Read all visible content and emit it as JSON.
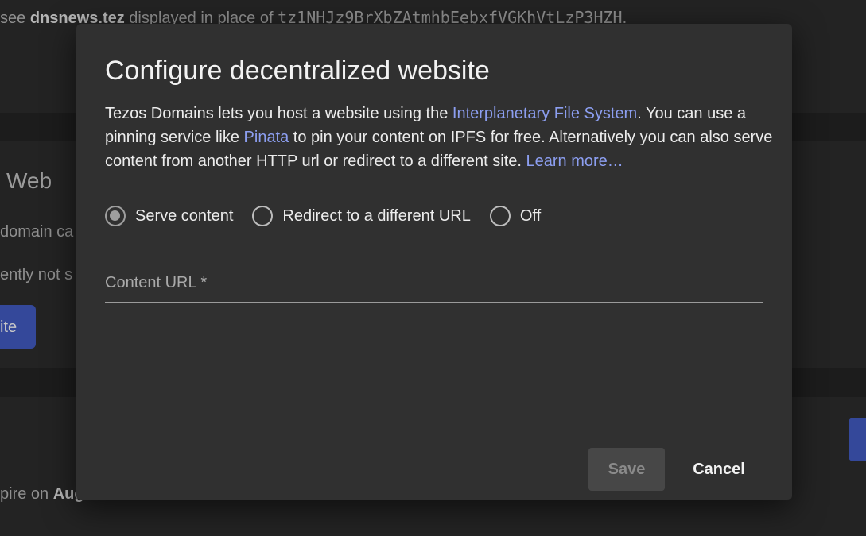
{
  "background": {
    "top_line": {
      "prefix": "see",
      "domain": "dnsnews.tez",
      "middle": "displayed in place of",
      "address": "tz1NHJz9BrXbZAtmhbEebxfVGKhVtLzP3HZH",
      "suffix": "."
    },
    "section_heading": "l Web",
    "line1": "domain ca",
    "line2": "ently not s",
    "button_fragment": "ite",
    "expire_prefix": "pire on",
    "expire_value": "Aug"
  },
  "dialog": {
    "title": "Configure decentralized website",
    "description": {
      "part1": "Tezos Domains lets you host a website using the ",
      "link_ipfs": "Interplanetary File System",
      "part2": ". You can use a pinning service like ",
      "link_pinata": "Pinata",
      "part3": " to pin your content on IPFS for free. Alternatively you can also serve content from another HTTP url or redirect to a different site. ",
      "link_learn": "Learn more…"
    },
    "options": [
      {
        "label": "Serve content",
        "checked": true
      },
      {
        "label": "Redirect to a different URL",
        "checked": false
      },
      {
        "label": "Off",
        "checked": false
      }
    ],
    "content_url": {
      "label": "Content URL *",
      "value": ""
    },
    "save_label": "Save",
    "cancel_label": "Cancel"
  },
  "colors": {
    "dialog_bg": "#303030",
    "link": "#8c9ef0",
    "primary_button": "#34489a"
  }
}
